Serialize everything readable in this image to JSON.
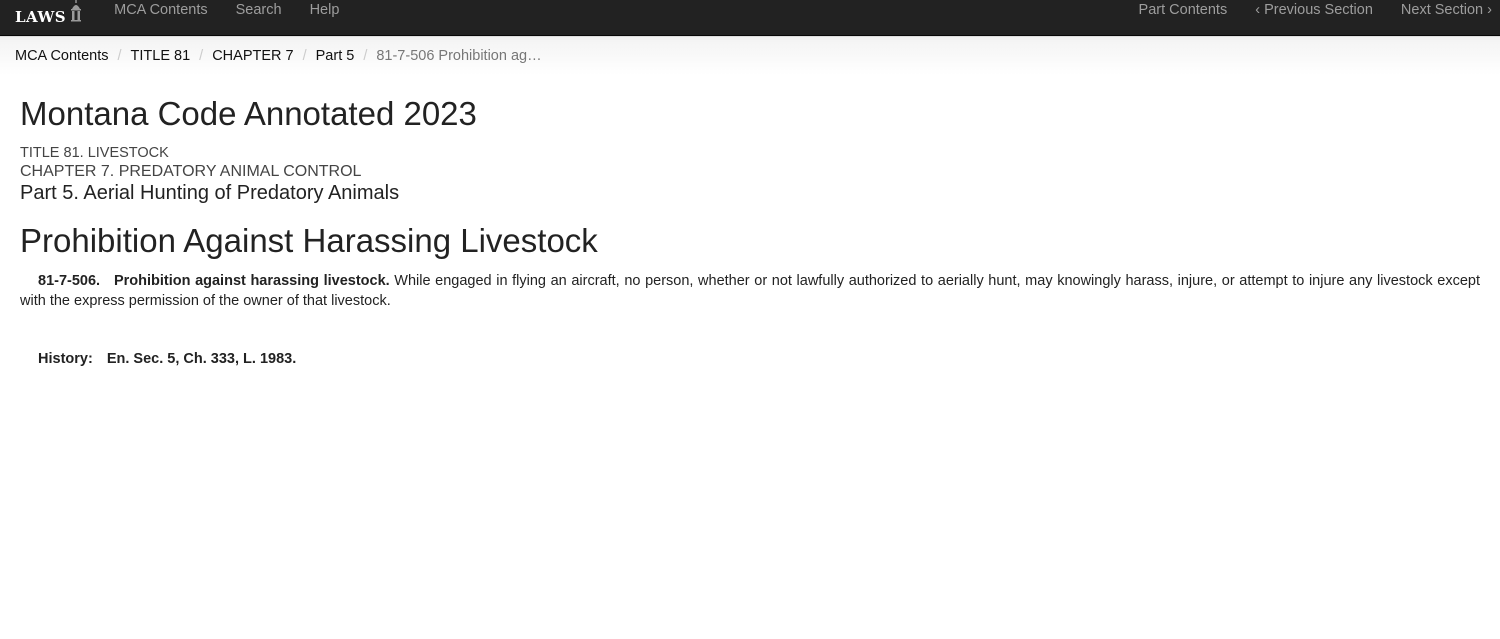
{
  "navbar": {
    "brand": "LAWS",
    "brand_icon": "capitol-dome-icon",
    "left_links": [
      "MCA Contents",
      "Search",
      "Help"
    ],
    "right_links": {
      "part_contents": "Part Contents",
      "previous_section": "Previous Section",
      "previous_chevron": "‹",
      "next_section": "Next Section",
      "next_chevron": "›"
    }
  },
  "breadcrumb": {
    "items": [
      "MCA Contents",
      "TITLE 81",
      "CHAPTER 7",
      "Part 5"
    ],
    "separator": "/",
    "current": "81-7-506 Prohibition ag…"
  },
  "header": {
    "code_title": "Montana Code Annotated 2023",
    "title": "TITLE 81. LIVESTOCK",
    "chapter": "CHAPTER 7. PREDATORY ANIMAL CONTROL",
    "part": "Part 5. Aerial Hunting of Predatory Animals"
  },
  "section": {
    "heading": "Prohibition Against Harassing Livestock",
    "number": "81-7-506.",
    "catchline": "Prohibition against harassing livestock.",
    "text": "While engaged in flying an aircraft, no person, whether or not lawfully authorized to aerially hunt, may knowingly harass, injure, or attempt to injure any livestock except with the express permission of the owner of that livestock."
  },
  "history": {
    "label": "History:",
    "text": "En. Sec. 5, Ch. 333, L. 1983."
  }
}
